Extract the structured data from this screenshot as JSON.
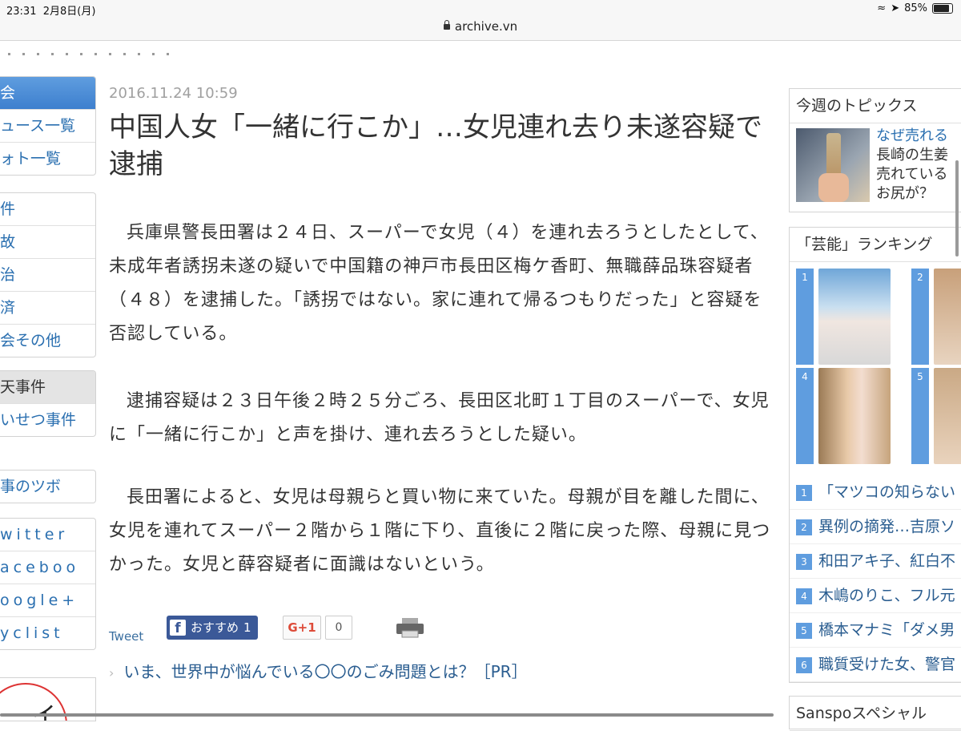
{
  "status": {
    "time": "23:31",
    "date": "2月8日(月)",
    "battery": "85%",
    "battery_level": 0.85
  },
  "browser": {
    "url": "archive.vn"
  },
  "left_nav": {
    "group1": [
      "会",
      "ュース一覧",
      "ォト一覧"
    ],
    "group2": [
      "件",
      "故",
      "治",
      "済",
      "会その他"
    ],
    "group3": [
      "天事件",
      "いせつ事件"
    ],
    "group4": [
      "事のツボ"
    ],
    "group5": [
      "witter",
      "aceboo",
      "oogle+",
      "yclist"
    ],
    "banner_text": "イ"
  },
  "article": {
    "date": "2016.11.24 10:59",
    "title": "中国人女「一緒に行こか」…女児連れ去り未遂容疑で逮捕",
    "paragraphs": [
      "兵庫県警長田署は２４日、スーパーで女児（４）を連れ去ろうとしたとして、未成年者誘拐未遂の疑いで中国籍の神戸市長田区梅ケ香町、無職薛品珠容疑者（４８）を逮捕した。「誘拐ではない。家に連れて帰るつもりだった」と容疑を否認している。",
      "逮捕容疑は２３日午後２時２５分ごろ、長田区北町１丁目のスーパーで、女児に「一緒に行こか」と声を掛け、連れ去ろうとした疑い。",
      "長田署によると、女児は母親らと買い物に来ていた。母親が目を離した間に、女児を連れてスーパー２階から１階に下り、直後に２階に戻った際、母親に見つかった。女児と薛容疑者に面識はないという。"
    ],
    "share": {
      "tweet": "Tweet",
      "fb_label": "おすすめ",
      "fb_count": "1",
      "gplus": "G+1",
      "gplus_count": "0"
    },
    "pr_link": "いま、世界中が悩んでいる〇〇のごみ問題とは？［PR］"
  },
  "right_col": {
    "topics_head": "今週のトピックス",
    "topic_lines": [
      "なぜ売れる",
      "長崎の生姜",
      "売れている",
      "お尻が？"
    ],
    "ranking_head": "「芸能」ランキング",
    "rank_img_nums": [
      "1",
      "2",
      "4",
      "5"
    ],
    "ranking": [
      {
        "n": "1",
        "text": "「マツコの知らない"
      },
      {
        "n": "2",
        "text": "異例の摘発…吉原ソ"
      },
      {
        "n": "3",
        "text": "和田アキ子、紅白不"
      },
      {
        "n": "4",
        "text": "木嶋のりこ、フル元"
      },
      {
        "n": "5",
        "text": "橋本マナミ「ダメ男"
      },
      {
        "n": "6",
        "text": "職質受けた女、警官"
      }
    ],
    "special_head": "Sanspoスペシャル"
  },
  "colors": {
    "nav_blue": "#3d7fce",
    "link": "#2a5d90",
    "fb": "#3b5998",
    "gplus": "#dd4b39"
  }
}
